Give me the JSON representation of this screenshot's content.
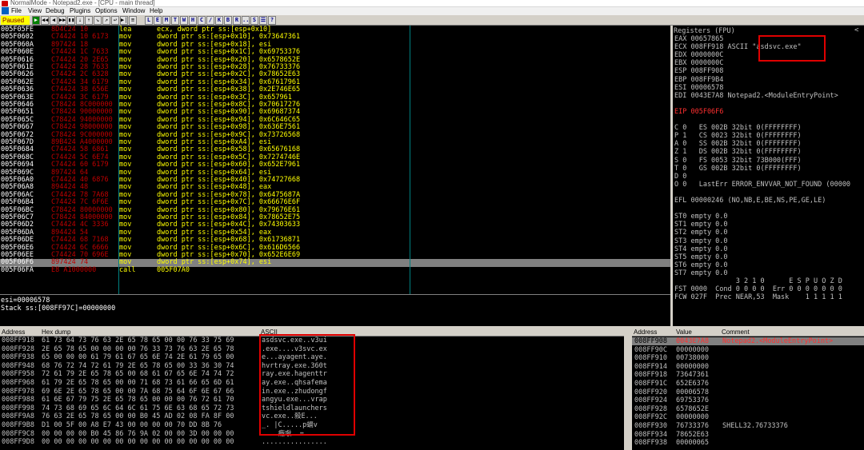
{
  "window": {
    "title": "NormalMode - Notepad2.exe - [CPU - main thread]"
  },
  "menu": [
    "File",
    "View",
    "Debug",
    "Plugins",
    "Options",
    "Window",
    "Help"
  ],
  "toolbar": {
    "status": "Paused",
    "buttons": [
      "▶",
      "◀◀",
      "◀",
      "▶▶",
      "▮▮",
      "⇣",
      "⇡",
      "↘",
      "↗",
      "↩",
      "▶|",
      "≡",
      "L",
      "E",
      "M",
      "T",
      "W",
      "H",
      "C",
      "/",
      "K",
      "B",
      "R",
      "...",
      "S",
      "☰",
      "?"
    ]
  },
  "disasm": {
    "rows": [
      {
        "addr": "005F05FE",
        "hex": "8D4C24 10",
        "mn": "lea",
        "op": "ecx, dword ptr ss:[esp+0x10]"
      },
      {
        "addr": "005F0602",
        "hex": "C74424 10 6173",
        "mn": "mov",
        "op": "dword ptr ss:[esp+0x10], 0x73647361"
      },
      {
        "addr": "005F060A",
        "hex": "897424 18",
        "mn": "mov",
        "op": "dword ptr ss:[esp+0x18], esi"
      },
      {
        "addr": "005F060E",
        "hex": "C74424 1C 7633",
        "mn": "mov",
        "op": "dword ptr ss:[esp+0x1C], 0x69753376"
      },
      {
        "addr": "005F0616",
        "hex": "C74424 20 2E65",
        "mn": "mov",
        "op": "dword ptr ss:[esp+0x20], 0x6578652E"
      },
      {
        "addr": "005F061E",
        "hex": "C74424 28 7633",
        "mn": "mov",
        "op": "dword ptr ss:[esp+0x28], 0x76733376"
      },
      {
        "addr": "005F0626",
        "hex": "C74424 2C 6328",
        "mn": "mov",
        "op": "dword ptr ss:[esp+0x2C], 0x78652E63"
      },
      {
        "addr": "005F062E",
        "hex": "C74424 34 6179",
        "mn": "mov",
        "op": "dword ptr ss:[esp+0x34], 0x67617961"
      },
      {
        "addr": "005F0636",
        "hex": "C74424 38 656E",
        "mn": "mov",
        "op": "dword ptr ss:[esp+0x38], 0x2E746E65"
      },
      {
        "addr": "005F063E",
        "hex": "C74424 3C 6179",
        "mn": "mov",
        "op": "dword ptr ss:[esp+0x3C], 0x657961"
      },
      {
        "addr": "005F0646",
        "hex": "C78424 8C000000",
        "mn": "mov",
        "op": "dword ptr ss:[esp+0x8C], 0x70617276"
      },
      {
        "addr": "005F0651",
        "hex": "C78424 90000000",
        "mn": "mov",
        "op": "dword ptr ss:[esp+0x90], 0x69687374"
      },
      {
        "addr": "005F065C",
        "hex": "C78424 94000000",
        "mn": "mov",
        "op": "dword ptr ss:[esp+0x94], 0x6C646C65"
      },
      {
        "addr": "005F0667",
        "hex": "C78424 98000000",
        "mn": "mov",
        "op": "dword ptr ss:[esp+0x98], 0x636E7561"
      },
      {
        "addr": "005F0672",
        "hex": "C78424 9C000000",
        "mn": "mov",
        "op": "dword ptr ss:[esp+0x9C], 0x73726568"
      },
      {
        "addr": "005F067D",
        "hex": "89B424 A4000000",
        "mn": "mov",
        "op": "dword ptr ss:[esp+0xA4], esi"
      },
      {
        "addr": "005F0684",
        "hex": "C74424 58 6861",
        "mn": "mov",
        "op": "dword ptr ss:[esp+0x58], 0x65676168"
      },
      {
        "addr": "005F068C",
        "hex": "C74424 5C 6E74",
        "mn": "mov",
        "op": "dword ptr ss:[esp+0x5C], 0x7274746E"
      },
      {
        "addr": "005F0694",
        "hex": "C74424 60 6179",
        "mn": "mov",
        "op": "dword ptr ss:[esp+0x60], 0x652E7961"
      },
      {
        "addr": "005F069C",
        "hex": "897424 64",
        "mn": "mov",
        "op": "dword ptr ss:[esp+0x64], esi"
      },
      {
        "addr": "005F06A0",
        "hex": "C74424 40 6876",
        "mn": "mov",
        "op": "dword ptr ss:[esp+0x40], 0x74727668"
      },
      {
        "addr": "005F06A8",
        "hex": "894424 48",
        "mn": "mov",
        "op": "dword ptr ss:[esp+0x48], eax"
      },
      {
        "addr": "005F06AC",
        "hex": "C74424 78 7A68",
        "mn": "mov",
        "op": "dword ptr ss:[esp+0x78], 0x6475687A"
      },
      {
        "addr": "005F06B4",
        "hex": "C74424 7C 6F6E",
        "mn": "mov",
        "op": "dword ptr ss:[esp+0x7C], 0x66676E6F"
      },
      {
        "addr": "005F06BC",
        "hex": "C78424 80000000",
        "mn": "mov",
        "op": "dword ptr ss:[esp+0x80], 0x79676E61"
      },
      {
        "addr": "005F06C7",
        "hex": "C78424 84000000",
        "mn": "mov",
        "op": "dword ptr ss:[esp+0x84], 0x78652E75"
      },
      {
        "addr": "005F06D2",
        "hex": "C74424 4C 3336",
        "mn": "mov",
        "op": "dword ptr ss:[esp+0x4C], 0x74303633"
      },
      {
        "addr": "005F06DA",
        "hex": "894424 54",
        "mn": "mov",
        "op": "dword ptr ss:[esp+0x54], eax"
      },
      {
        "addr": "005F06DE",
        "hex": "C74424 68 7168",
        "mn": "mov",
        "op": "dword ptr ss:[esp+0x68], 0x61736871"
      },
      {
        "addr": "005F06E6",
        "hex": "C74424 6C 6666",
        "mn": "mov",
        "op": "dword ptr ss:[esp+0x6C], 0x616D6566"
      },
      {
        "addr": "005F06EE",
        "hex": "C74424 70 696E",
        "mn": "mov",
        "op": "dword ptr ss:[esp+0x70], 0x652E6E69"
      },
      {
        "addr": "005F06F6",
        "hex": "897424 74",
        "mn": "mov",
        "op": "dword ptr ss:[esp+0x74], esi",
        "selected": true
      },
      {
        "addr": "005F06FA",
        "hex": "E8 A1000000",
        "mn": "call",
        "op": "005F07A0"
      }
    ]
  },
  "info": {
    "line1": "esi=00006578",
    "line2": "Stack ss:[008FF97C]=00000000"
  },
  "registers": {
    "title": "Registers (FPU)",
    "lines": [
      "EAX 00657865",
      "ECX 008FF918 ASCII \"asdsvc.exe\"",
      "EDX 0000000C",
      "EBX 0000000C",
      "ESP 008FF908",
      "EBP 008FF9B4",
      "ESI 00006578",
      "EDI 0043E7A8 Notepad2.<ModuleEntryPoint>",
      "",
      "EIP 005F06F6",
      "",
      "C 0   ES 002B 32bit 0(FFFFFFFF)",
      "P 1   CS 0023 32bit 0(FFFFFFFF)",
      "A 0   SS 002B 32bit 0(FFFFFFFF)",
      "Z 1   DS 002B 32bit 0(FFFFFFFF)",
      "S 0   FS 0053 32bit 73B000(FFF)",
      "T 0   GS 002B 32bit 0(FFFFFFFF)",
      "D 0",
      "O 0   LastErr ERROR_ENVVAR_NOT_FOUND (00000",
      "",
      "EFL 00000246 (NO,NB,E,BE,NS,PE,GE,LE)",
      "",
      "ST0 empty 0.0",
      "ST1 empty 0.0",
      "ST2 empty 0.0",
      "ST3 empty 0.0",
      "ST4 empty 0.0",
      "ST5 empty 0.0",
      "ST6 empty 0.0",
      "ST7 empty 0.0",
      "               3 2 1 0      E S P U O Z D",
      "FST 0000  Cond 0 0 0 0  Err 0 0 0 0 0 0 0",
      "FCW 027F  Prec NEAR,53  Mask    1 1 1 1 1"
    ]
  },
  "dump": {
    "headers": {
      "address": "Address",
      "hex": "Hex dump",
      "ascii": "ASCII"
    },
    "rows": [
      {
        "addr": "008FF918",
        "hex": "61 73 64 73 76 63 2E 65 78 65 00 00 76 33 75 69",
        "ascii": "asdsvc.exe..v3ui"
      },
      {
        "addr": "008FF928",
        "hex": "2E 65 78 65 00 00 00 00 76 33 73 76 63 2E 65 78",
        "ascii": ".exe....v3svc.ex"
      },
      {
        "addr": "008FF938",
        "hex": "65 00 00 00 61 79 61 67 65 6E 74 2E 61 79 65 00",
        "ascii": "e...ayagent.aye."
      },
      {
        "addr": "008FF948",
        "hex": "68 76 72 74 72 61 79 2E 65 78 65 00 33 36 30 74",
        "ascii": "hvrtray.exe.360t"
      },
      {
        "addr": "008FF958",
        "hex": "72 61 79 2E 65 78 65 00 68 61 67 65 6E 74 74 72",
        "ascii": "ray.exe.hagenttr"
      },
      {
        "addr": "008FF968",
        "hex": "61 79 2E 65 78 65 00 00 71 68 73 61 66 65 6D 61",
        "ascii": "ay.exe..qhsafema"
      },
      {
        "addr": "008FF978",
        "hex": "69 6E 2E 65 78 65 00 00 7A 68 75 64 6F 6E 67 66",
        "ascii": "in.exe..zhudongf"
      },
      {
        "addr": "008FF988",
        "hex": "61 6E 67 79 75 2E 65 78 65 00 00 00 76 72 61 70",
        "ascii": "angyu.exe...vrap"
      },
      {
        "addr": "008FF998",
        "hex": "74 73 68 69 65 6C 64 6C 61 75 6E 63 68 65 72 73",
        "ascii": "tshieldlaunchers"
      },
      {
        "addr": "008FF9A8",
        "hex": "76 63 2E 65 78 65 00 00 B0 45 AD 02 08 FA 8F 00",
        "ascii": "vc.exe..殺E..."
      },
      {
        "addr": "008FF9B8",
        "hex": "D1 00 5F 00 A8 E7 43 00 00 00 00 70 DD 8B 76",
        "ascii": "_. |C.....p螎v"
      },
      {
        "addr": "008FF9C8",
        "hex": "00 00 00 00 B0 45 86 76 9A 02 00 00 3D 00 00 00",
        "ascii": "....癊唙..="
      },
      {
        "addr": "008FF9D8",
        "hex": "00 00 00 00 00 00 00 00 00 00 00 00 00 00 00 00",
        "ascii": "................"
      }
    ]
  },
  "stack": {
    "headers": {
      "address": "Address",
      "value": "Value",
      "comment": "Comment"
    },
    "rows": [
      {
        "addr": "008FF908",
        "val": "0043E7A8",
        "cmt": "Notepad2.<ModuleEntryPoint>",
        "selected": true
      },
      {
        "addr": "008FF90C",
        "val": "00000000",
        "cmt": ""
      },
      {
        "addr": "008FF910",
        "val": "00738000",
        "cmt": ""
      },
      {
        "addr": "008FF914",
        "val": "00000000",
        "cmt": ""
      },
      {
        "addr": "008FF918",
        "val": "73647361",
        "cmt": ""
      },
      {
        "addr": "008FF91C",
        "val": "652E6376",
        "cmt": ""
      },
      {
        "addr": "008FF920",
        "val": "00006578",
        "cmt": ""
      },
      {
        "addr": "008FF924",
        "val": "69753376",
        "cmt": ""
      },
      {
        "addr": "008FF928",
        "val": "6578652E",
        "cmt": ""
      },
      {
        "addr": "008FF92C",
        "val": "00000000",
        "cmt": ""
      },
      {
        "addr": "008FF930",
        "val": "76733376",
        "cmt": "SHELL32.76733376"
      },
      {
        "addr": "008FF934",
        "val": "78652E63",
        "cmt": ""
      },
      {
        "addr": "008FF938",
        "val": "00000065",
        "cmt": ""
      }
    ]
  }
}
